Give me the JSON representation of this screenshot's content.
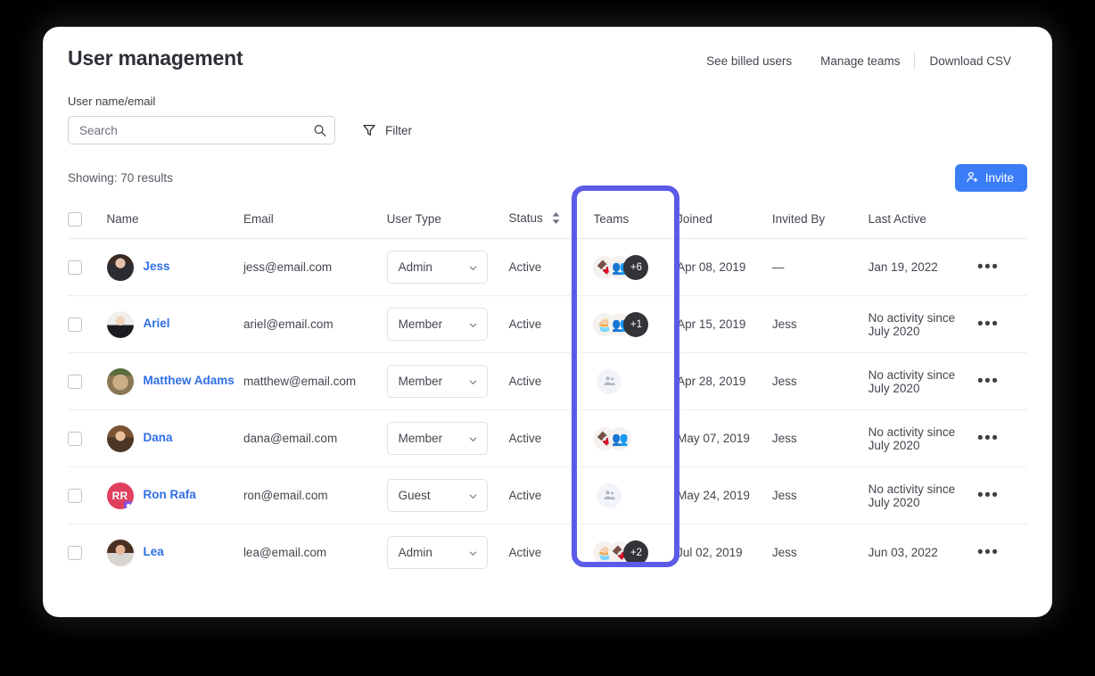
{
  "header": {
    "title": "User management",
    "links": [
      "See billed users",
      "Manage teams",
      "Download CSV"
    ]
  },
  "search": {
    "label": "User name/email",
    "placeholder": "Search",
    "value": "",
    "search_icon": "search-icon",
    "filter_label": "Filter",
    "filter_icon": "filter-icon"
  },
  "toolbar": {
    "showing": "Showing: 70 results",
    "invite_label": "Invite",
    "invite_icon": "user-plus-icon",
    "accent_color": "#3b7df6"
  },
  "highlight": {
    "target_column": "Teams",
    "color": "#5b5be8"
  },
  "table": {
    "columns": [
      "",
      "Name",
      "Email",
      "User Type",
      "Status",
      "Teams",
      "Joined",
      "Invited By",
      "Last Active",
      ""
    ],
    "sortable_column": "Status",
    "rows": [
      {
        "name": "Jess",
        "email": "jess@email.com",
        "user_type": "Admin",
        "status": "Active",
        "teams_extra": "+6",
        "teams_empty": false,
        "joined": "Apr 08, 2019",
        "invited_by": "—",
        "last_active": "Jan 19, 2022",
        "avatar_kind": "photo",
        "avatar_initials": "",
        "avatar_color": "",
        "avatar_badge": false
      },
      {
        "name": "Ariel",
        "email": "ariel@email.com",
        "user_type": "Member",
        "status": "Active",
        "teams_extra": "+1",
        "teams_empty": false,
        "joined": "Apr 15, 2019",
        "invited_by": "Jess",
        "last_active": "No activity since July 2020",
        "avatar_kind": "photo",
        "avatar_initials": "",
        "avatar_color": "",
        "avatar_badge": false
      },
      {
        "name": "Matthew Adams",
        "email": "matthew@email.com",
        "user_type": "Member",
        "status": "Active",
        "teams_extra": "",
        "teams_empty": true,
        "joined": "Apr 28, 2019",
        "invited_by": "Jess",
        "last_active": "No activity since July 2020",
        "avatar_kind": "photo",
        "avatar_initials": "",
        "avatar_color": "",
        "avatar_badge": false
      },
      {
        "name": "Dana",
        "email": "dana@email.com",
        "user_type": "Member",
        "status": "Active",
        "teams_extra": "",
        "teams_empty": false,
        "joined": "May 07, 2019",
        "invited_by": "Jess",
        "last_active": "No activity since July 2020",
        "avatar_kind": "photo",
        "avatar_initials": "",
        "avatar_color": "",
        "avatar_badge": false
      },
      {
        "name": "Ron Rafa",
        "email": "ron@email.com",
        "user_type": "Guest",
        "status": "Active",
        "teams_extra": "",
        "teams_empty": true,
        "joined": "May 24, 2019",
        "invited_by": "Jess",
        "last_active": "No activity since July 2020",
        "avatar_kind": "initials",
        "avatar_initials": "RR",
        "avatar_color": "#e0405e",
        "avatar_badge": true
      },
      {
        "name": "Lea",
        "email": "lea@email.com",
        "user_type": "Admin",
        "status": "Active",
        "teams_extra": "+2",
        "teams_empty": false,
        "joined": "Jul 02, 2019",
        "invited_by": "Jess",
        "last_active": "Jun 03, 2022",
        "avatar_kind": "photo",
        "avatar_initials": "",
        "avatar_color": "",
        "avatar_badge": false
      }
    ],
    "row_menu_icon": "ellipsis-icon"
  }
}
